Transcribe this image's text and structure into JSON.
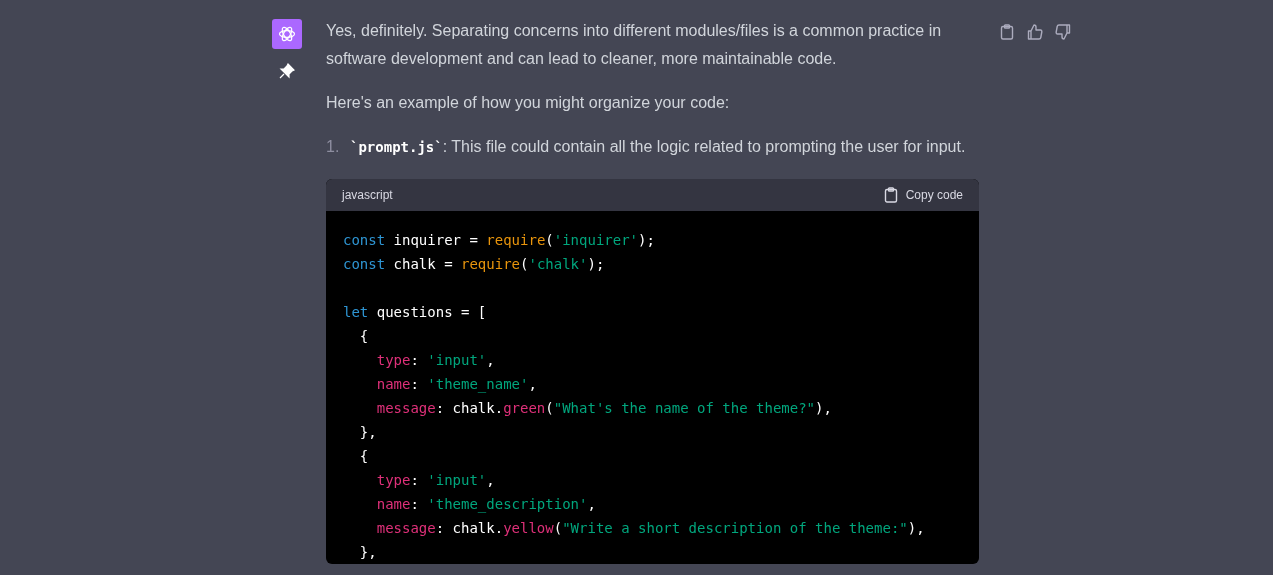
{
  "message": {
    "paragraphs": [
      "Yes, definitely. Separating concerns into different modules/files is a common practice in software development and can lead to cleaner, more maintainable code.",
      "Here's an example of how you might organize your code:"
    ],
    "list": [
      {
        "number": "1.",
        "code": "`prompt.js`",
        "text": ": This file could contain all the logic related to prompting the user for input."
      }
    ],
    "code_block": {
      "language": "javascript",
      "copy_label": "Copy code",
      "lines": [
        {
          "kind": "code",
          "tokens": [
            {
              "kind": "keyword",
              "text": "const"
            },
            {
              "kind": "plain",
              "text": " inquirer = "
            },
            {
              "kind": "func",
              "text": "require"
            },
            {
              "kind": "plain",
              "text": "("
            },
            {
              "kind": "string",
              "text": "'inquirer'"
            },
            {
              "kind": "plain",
              "text": ");"
            }
          ]
        },
        {
          "kind": "code",
          "tokens": [
            {
              "kind": "keyword",
              "text": "const"
            },
            {
              "kind": "plain",
              "text": " chalk = "
            },
            {
              "kind": "func",
              "text": "require"
            },
            {
              "kind": "plain",
              "text": "("
            },
            {
              "kind": "string",
              "text": "'chalk'"
            },
            {
              "kind": "plain",
              "text": ");"
            }
          ]
        },
        {
          "kind": "blank"
        },
        {
          "kind": "code",
          "tokens": [
            {
              "kind": "keyword",
              "text": "let"
            },
            {
              "kind": "plain",
              "text": " questions = ["
            }
          ],
          "children": [
            {
              "kind": "code",
              "tokens": [
                {
                  "kind": "plain",
                  "text": "{"
                }
              ],
              "children": [
                {
                  "kind": "code",
                  "tokens": [
                    {
                      "kind": "prop",
                      "text": "type"
                    },
                    {
                      "kind": "plain",
                      "text": ": "
                    },
                    {
                      "kind": "string",
                      "text": "'input'"
                    },
                    {
                      "kind": "plain",
                      "text": ","
                    }
                  ]
                },
                {
                  "kind": "code",
                  "tokens": [
                    {
                      "kind": "prop",
                      "text": "name"
                    },
                    {
                      "kind": "plain",
                      "text": ": "
                    },
                    {
                      "kind": "string",
                      "text": "'theme_name'"
                    },
                    {
                      "kind": "plain",
                      "text": ","
                    }
                  ]
                },
                {
                  "kind": "code",
                  "tokens": [
                    {
                      "kind": "prop",
                      "text": "message"
                    },
                    {
                      "kind": "plain",
                      "text": ": chalk."
                    },
                    {
                      "kind": "prop",
                      "text": "green"
                    },
                    {
                      "kind": "plain",
                      "text": "("
                    },
                    {
                      "kind": "string",
                      "text": "\"What's the name of the theme?\""
                    },
                    {
                      "kind": "plain",
                      "text": "),"
                    }
                  ]
                }
              ]
            },
            {
              "kind": "code",
              "tokens": [
                {
                  "kind": "plain",
                  "text": "},"
                }
              ]
            },
            {
              "kind": "code",
              "tokens": [
                {
                  "kind": "plain",
                  "text": "{"
                }
              ],
              "children": [
                {
                  "kind": "code",
                  "tokens": [
                    {
                      "kind": "prop",
                      "text": "type"
                    },
                    {
                      "kind": "plain",
                      "text": ": "
                    },
                    {
                      "kind": "string",
                      "text": "'input'"
                    },
                    {
                      "kind": "plain",
                      "text": ","
                    }
                  ]
                },
                {
                  "kind": "code",
                  "tokens": [
                    {
                      "kind": "prop",
                      "text": "name"
                    },
                    {
                      "kind": "plain",
                      "text": ": "
                    },
                    {
                      "kind": "string",
                      "text": "'theme_description'"
                    },
                    {
                      "kind": "plain",
                      "text": ","
                    }
                  ]
                },
                {
                  "kind": "code",
                  "tokens": [
                    {
                      "kind": "prop",
                      "text": "message"
                    },
                    {
                      "kind": "plain",
                      "text": ": chalk."
                    },
                    {
                      "kind": "prop",
                      "text": "yellow"
                    },
                    {
                      "kind": "plain",
                      "text": "("
                    },
                    {
                      "kind": "string",
                      "text": "\"Write a short description of the theme:\""
                    },
                    {
                      "kind": "plain",
                      "text": "),"
                    }
                  ]
                }
              ]
            },
            {
              "kind": "code",
              "tokens": [
                {
                  "kind": "plain",
                  "text": "},"
                }
              ]
            }
          ]
        }
      ]
    }
  }
}
